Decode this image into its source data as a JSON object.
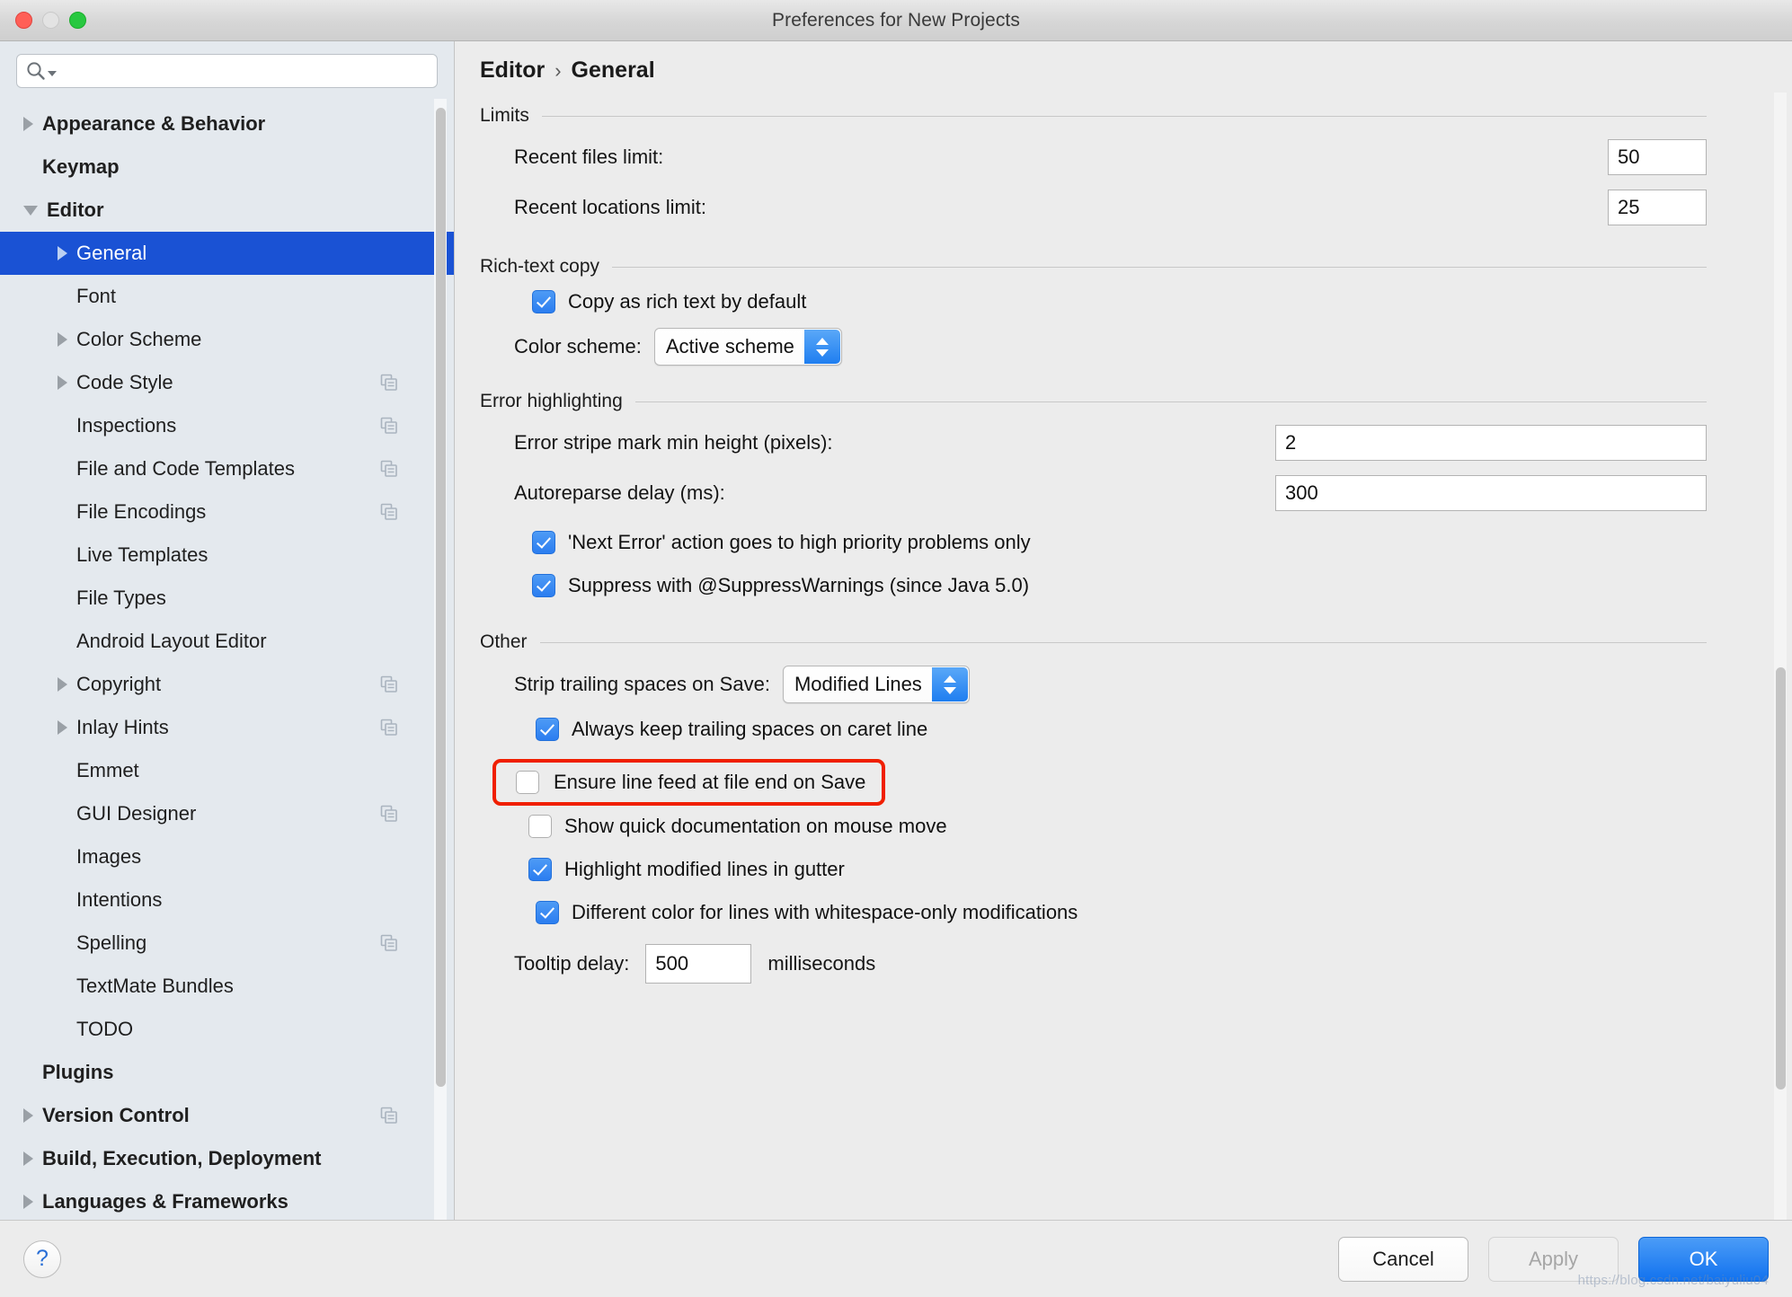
{
  "window": {
    "title": "Preferences for New Projects",
    "traffic_lights": [
      "close",
      "minimize",
      "zoom"
    ]
  },
  "search": {
    "placeholder": "",
    "value": "",
    "icon": "search-icon"
  },
  "sidebar": {
    "items": [
      {
        "label": "Appearance & Behavior",
        "arrow": "right",
        "bold": true,
        "indent": 0,
        "selected": false,
        "copy_icon": false
      },
      {
        "label": "Keymap",
        "arrow": "none",
        "bold": true,
        "indent": 0,
        "selected": false,
        "copy_icon": false
      },
      {
        "label": "Editor",
        "arrow": "down",
        "bold": true,
        "indent": 0,
        "selected": false,
        "copy_icon": false
      },
      {
        "label": "General",
        "arrow": "right",
        "bold": false,
        "indent": 1,
        "selected": true,
        "copy_icon": false
      },
      {
        "label": "Font",
        "arrow": "none",
        "bold": false,
        "indent": 1,
        "selected": false,
        "copy_icon": false
      },
      {
        "label": "Color Scheme",
        "arrow": "right",
        "bold": false,
        "indent": 1,
        "selected": false,
        "copy_icon": false
      },
      {
        "label": "Code Style",
        "arrow": "right",
        "bold": false,
        "indent": 1,
        "selected": false,
        "copy_icon": true
      },
      {
        "label": "Inspections",
        "arrow": "none",
        "bold": false,
        "indent": 1,
        "selected": false,
        "copy_icon": true
      },
      {
        "label": "File and Code Templates",
        "arrow": "none",
        "bold": false,
        "indent": 1,
        "selected": false,
        "copy_icon": true
      },
      {
        "label": "File Encodings",
        "arrow": "none",
        "bold": false,
        "indent": 1,
        "selected": false,
        "copy_icon": true
      },
      {
        "label": "Live Templates",
        "arrow": "none",
        "bold": false,
        "indent": 1,
        "selected": false,
        "copy_icon": false
      },
      {
        "label": "File Types",
        "arrow": "none",
        "bold": false,
        "indent": 1,
        "selected": false,
        "copy_icon": false
      },
      {
        "label": "Android Layout Editor",
        "arrow": "none",
        "bold": false,
        "indent": 1,
        "selected": false,
        "copy_icon": false
      },
      {
        "label": "Copyright",
        "arrow": "right",
        "bold": false,
        "indent": 1,
        "selected": false,
        "copy_icon": true
      },
      {
        "label": "Inlay Hints",
        "arrow": "right",
        "bold": false,
        "indent": 1,
        "selected": false,
        "copy_icon": true
      },
      {
        "label": "Emmet",
        "arrow": "none",
        "bold": false,
        "indent": 1,
        "selected": false,
        "copy_icon": false
      },
      {
        "label": "GUI Designer",
        "arrow": "none",
        "bold": false,
        "indent": 1,
        "selected": false,
        "copy_icon": true
      },
      {
        "label": "Images",
        "arrow": "none",
        "bold": false,
        "indent": 1,
        "selected": false,
        "copy_icon": false
      },
      {
        "label": "Intentions",
        "arrow": "none",
        "bold": false,
        "indent": 1,
        "selected": false,
        "copy_icon": false
      },
      {
        "label": "Spelling",
        "arrow": "none",
        "bold": false,
        "indent": 1,
        "selected": false,
        "copy_icon": true
      },
      {
        "label": "TextMate Bundles",
        "arrow": "none",
        "bold": false,
        "indent": 1,
        "selected": false,
        "copy_icon": false
      },
      {
        "label": "TODO",
        "arrow": "none",
        "bold": false,
        "indent": 1,
        "selected": false,
        "copy_icon": false
      },
      {
        "label": "Plugins",
        "arrow": "none",
        "bold": true,
        "indent": 0,
        "selected": false,
        "copy_icon": false
      },
      {
        "label": "Version Control",
        "arrow": "right",
        "bold": true,
        "indent": 0,
        "selected": false,
        "copy_icon": true
      },
      {
        "label": "Build, Execution, Deployment",
        "arrow": "right",
        "bold": true,
        "indent": 0,
        "selected": false,
        "copy_icon": false
      },
      {
        "label": "Languages & Frameworks",
        "arrow": "right",
        "bold": true,
        "indent": 0,
        "selected": false,
        "copy_icon": false
      }
    ]
  },
  "breadcrumb": {
    "parent": "Editor",
    "separator": "›",
    "current": "General"
  },
  "groups": {
    "limits": {
      "title": "Limits",
      "recent_files_label": "Recent files limit:",
      "recent_files_value": "50",
      "recent_locations_label": "Recent locations limit:",
      "recent_locations_value": "25"
    },
    "rich_text_copy": {
      "title": "Rich-text copy",
      "copy_default_label": "Copy as rich text by default",
      "copy_default_checked": true,
      "color_scheme_label": "Color scheme:",
      "color_scheme_value": "Active scheme"
    },
    "error_highlighting": {
      "title": "Error highlighting",
      "stripe_label": "Error stripe mark min height (pixels):",
      "stripe_value": "2",
      "autoreparse_label": "Autoreparse delay (ms):",
      "autoreparse_value": "300",
      "next_error_label": "'Next Error' action goes to high priority problems only",
      "next_error_checked": true,
      "suppress_label": "Suppress with @SuppressWarnings (since Java 5.0)",
      "suppress_checked": true
    },
    "other": {
      "title": "Other",
      "strip_label": "Strip trailing spaces on Save:",
      "strip_value": "Modified Lines",
      "keep_trailing_label": "Always keep trailing spaces on caret line",
      "keep_trailing_checked": true,
      "ensure_linefeed_label": "Ensure line feed at file end on Save",
      "ensure_linefeed_checked": false,
      "ensure_linefeed_highlight_color": "#f01f00",
      "quick_doc_label": "Show quick documentation on mouse move",
      "quick_doc_checked": false,
      "highlight_modified_label": "Highlight modified lines in gutter",
      "highlight_modified_checked": true,
      "different_color_label": "Different color for lines with whitespace-only modifications",
      "different_color_checked": true,
      "tooltip_delay_label": "Tooltip delay:",
      "tooltip_delay_value": "500",
      "tooltip_delay_unit": "milliseconds"
    }
  },
  "footer": {
    "help_label": "?",
    "cancel_label": "Cancel",
    "apply_label": "Apply",
    "ok_label": "OK",
    "watermark": "https://blog.csdn.net/baiyuliu04"
  },
  "colors": {
    "selection_blue": "#1a52d4",
    "accent_blue": "#1172ef",
    "highlight_red": "#f01f00",
    "sidebar_bg": "#e4e9ee",
    "panel_bg": "#ececec"
  }
}
